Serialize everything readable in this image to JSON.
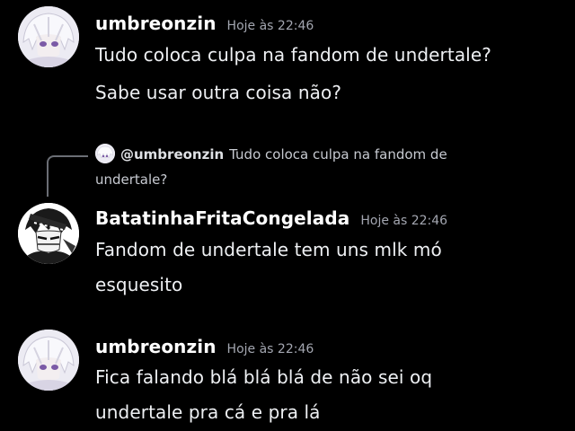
{
  "messages": [
    {
      "author": "umbreonzin",
      "timestamp": "Hoje às 22:46",
      "avatar": "white-haired-anime-avatar",
      "lines": [
        "Tudo coloca culpa na fandom de undertale?",
        "Sabe usar outra coisa não?"
      ]
    },
    {
      "author": "BatatinhaFritaCongelada",
      "timestamp": "Hoje às 22:46",
      "avatar": "dark-anime-character-avatar",
      "reply": {
        "mention": "@umbreonzin",
        "text": "Tudo coloca culpa na fandom de undertale?"
      },
      "lines": [
        "Fandom de undertale tem uns mlk mó",
        "esquesito"
      ]
    },
    {
      "author": "umbreonzin",
      "timestamp": "Hoje às 22:46",
      "avatar": "white-haired-anime-avatar",
      "lines": [
        "Fica falando blá blá blá de não sei oq",
        "undertale pra cá e pra lá"
      ]
    }
  ],
  "colors": {
    "background": "#000000",
    "username": "#ffffff",
    "timestamp": "#a3a6b0",
    "message_text": "#eef0f3",
    "reply_text": "#c7cad1",
    "connector": "#6b6e75"
  }
}
